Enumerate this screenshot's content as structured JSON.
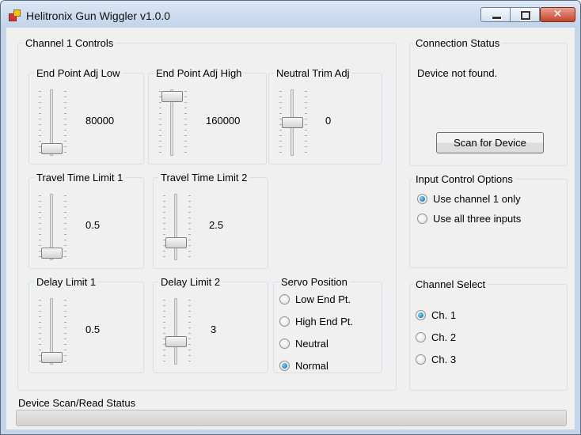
{
  "window": {
    "title": "Helitronix Gun Wiggler v1.0.0",
    "close_glyph": "✕"
  },
  "channel_controls": {
    "title": "Channel 1 Controls",
    "sliders": [
      {
        "label": "End Point Adj Low",
        "value": "80000",
        "level": 0
      },
      {
        "label": "End Point Adj High",
        "value": "160000",
        "level": 1
      },
      {
        "label": "Neutral Trim Adj",
        "value": "0",
        "level": 0.5
      },
      {
        "label": "Travel Time Limit 1",
        "value": "0.5",
        "level": 0
      },
      {
        "label": "Travel Time Limit 2",
        "value": "2.5",
        "level": 0.2
      },
      {
        "label": "Delay Limit 1",
        "value": "0.5",
        "level": 0
      },
      {
        "label": "Delay Limit 2",
        "value": "3",
        "level": 0.3
      }
    ],
    "servo_position": {
      "title": "Servo Position",
      "options": [
        "Low End Pt.",
        "High End Pt.",
        "Neutral",
        "Normal"
      ],
      "selected": "Normal"
    }
  },
  "connection_status": {
    "title": "Connection Status",
    "message": "Device not found.",
    "scan_button": "Scan for Device"
  },
  "input_control": {
    "title": "Input Control Options",
    "options": [
      "Use channel 1 only",
      "Use all three inputs"
    ],
    "selected": "Use channel 1 only"
  },
  "channel_select": {
    "title": "Channel Select",
    "options": [
      "Ch. 1",
      "Ch. 2",
      "Ch. 3"
    ],
    "selected": "Ch. 1"
  },
  "status_bar": {
    "label": "Device Scan/Read Status",
    "progress": 0
  }
}
